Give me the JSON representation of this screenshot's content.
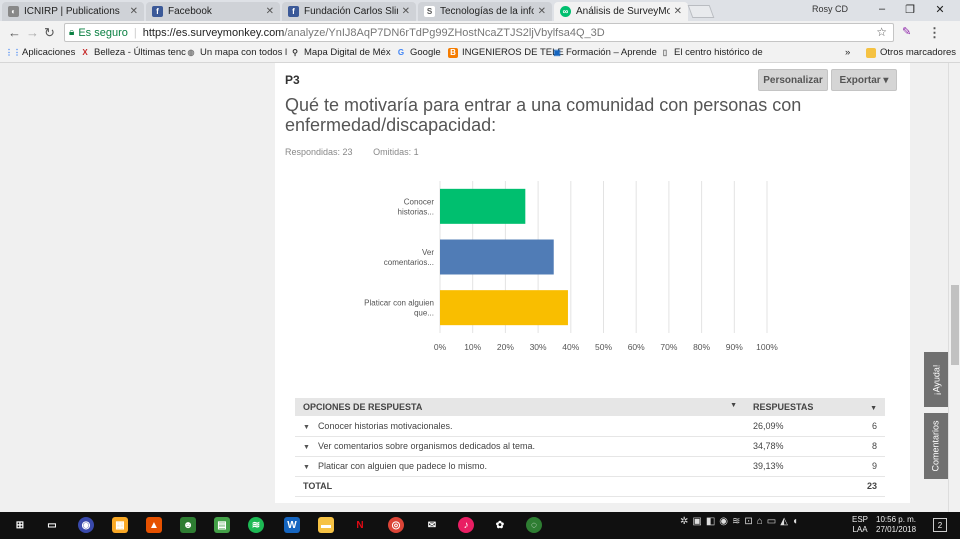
{
  "browser": {
    "tabs": [
      {
        "title": "ICNIRP | Publications",
        "active": false,
        "icon": "globe-icon",
        "color": "#888888"
      },
      {
        "title": "Facebook",
        "active": false,
        "icon": "facebook-icon",
        "color": "#3b5998"
      },
      {
        "title": "Fundación Carlos Slim Sa",
        "active": false,
        "icon": "facebook-icon",
        "color": "#3b5998"
      },
      {
        "title": "Tecnologías de la inform",
        "active": false,
        "icon": "s-icon",
        "color": "#555555"
      },
      {
        "title": "Análisis de SurveyMonke",
        "active": true,
        "icon": "surveymonkey-icon",
        "color": "#00bf6f"
      }
    ],
    "profile": "Rosy CD",
    "secure_label": "Es seguro",
    "url_host": "https://es.surveymonkey.com",
    "url_path": "/analyze/YnIJ8AqP7DN6rTdPg99ZHostNcaZTJS2ljVbylfsa4Q_3D",
    "bookmarks": [
      {
        "label": "Aplicaciones",
        "icon": "apps-icon",
        "color": "#4285f4"
      },
      {
        "label": "Belleza - Últimas tenc",
        "icon": "x-icon",
        "color": "#c62828"
      },
      {
        "label": "Un mapa con todos l",
        "icon": "globe-icon",
        "color": "#777777"
      },
      {
        "label": "Mapa Digital de Méx",
        "icon": "pin-icon",
        "color": "#333333"
      },
      {
        "label": "Google",
        "icon": "google-icon",
        "color": "#4285f4"
      },
      {
        "label": "INGENIEROS DE TELE",
        "icon": "blogger-icon",
        "color": "#f57c00"
      },
      {
        "label": "Formación – Aprende",
        "icon": "monitor-icon",
        "color": "#1565c0"
      },
      {
        "label": "El centro histórico de",
        "icon": "page-icon",
        "color": "#666666"
      }
    ],
    "other_bookmarks": "Otros marcadores"
  },
  "question": {
    "number": "P3",
    "title": "Qué te motivaría para entrar a una comunidad con personas con enfermedad/discapacidad:",
    "answered": "Respondidas: 23",
    "skipped": "Omitidas: 1",
    "customize_label": "Personalizar",
    "export_label": "Exportar ▾"
  },
  "chart_data": {
    "type": "bar",
    "orientation": "horizontal",
    "categories": [
      "Conocer historias...",
      "Ver comentarios...",
      "Platicar con alguien que..."
    ],
    "values": [
      26.09,
      34.78,
      39.13
    ],
    "colors": [
      "#00bf6f",
      "#507cb6",
      "#f9be00"
    ],
    "xlim": [
      0,
      100
    ],
    "ticks": [
      "0%",
      "10%",
      "20%",
      "30%",
      "40%",
      "50%",
      "60%",
      "70%",
      "80%",
      "90%",
      "100%"
    ],
    "grid": true
  },
  "table": {
    "header_option": "OPCIONES DE RESPUESTA",
    "header_responses": "RESPUESTAS",
    "rows": [
      {
        "option": "Conocer historias motivacionales.",
        "percent": "26,09%",
        "count": "6"
      },
      {
        "option": "Ver comentarios sobre organismos dedicados al tema.",
        "percent": "34,78%",
        "count": "8"
      },
      {
        "option": "Platicar con alguien que padece lo mismo.",
        "percent": "39,13%",
        "count": "9"
      }
    ],
    "total_label": "TOTAL",
    "total_count": "23"
  },
  "side_tabs": {
    "help": "¡Ayuda!",
    "comments": "Comentarios"
  },
  "taskbar": {
    "lang_top": "ESP",
    "lang_bottom": "LAA",
    "time": "10:56 p. m.",
    "date": "27/01/2018",
    "notifications": "2"
  }
}
